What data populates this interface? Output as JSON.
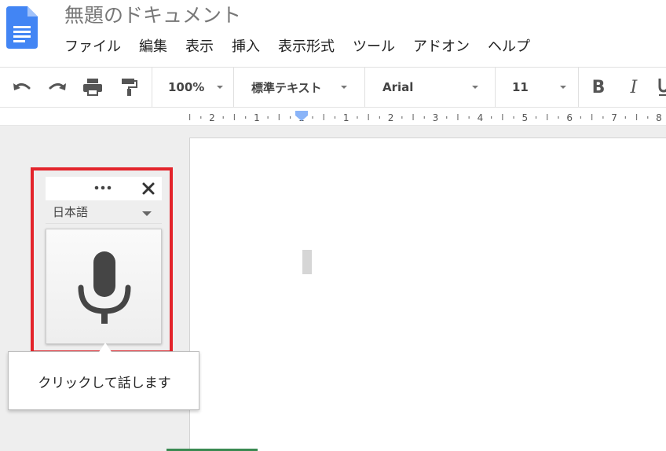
{
  "document": {
    "title": "無題のドキュメント"
  },
  "menu": [
    {
      "label": "ファイル"
    },
    {
      "label": "編集"
    },
    {
      "label": "表示"
    },
    {
      "label": "挿入"
    },
    {
      "label": "表示形式"
    },
    {
      "label": "ツール"
    },
    {
      "label": "アドオン"
    },
    {
      "label": "ヘルプ"
    }
  ],
  "toolbar": {
    "zoom": "100%",
    "style": "標準テキスト",
    "font": "Arial",
    "font_size": "11",
    "bold_label": "B",
    "italic_label": "I",
    "icons": [
      "undo-icon",
      "redo-icon",
      "print-icon",
      "paint-format-icon"
    ]
  },
  "ruler": {
    "labels": [
      "2",
      "1",
      "1",
      "1",
      "2",
      "3",
      "4",
      "5",
      "6",
      "7",
      "8"
    ]
  },
  "voice_typing": {
    "language": "日本語",
    "icons": [
      "more-icon",
      "close-icon",
      "microphone-icon"
    ]
  },
  "tooltip": {
    "text": "クリックして話します"
  },
  "colors": {
    "docs_blue": "#4285f4",
    "highlight_red": "#e3242b",
    "icon_gray": "#555555"
  }
}
